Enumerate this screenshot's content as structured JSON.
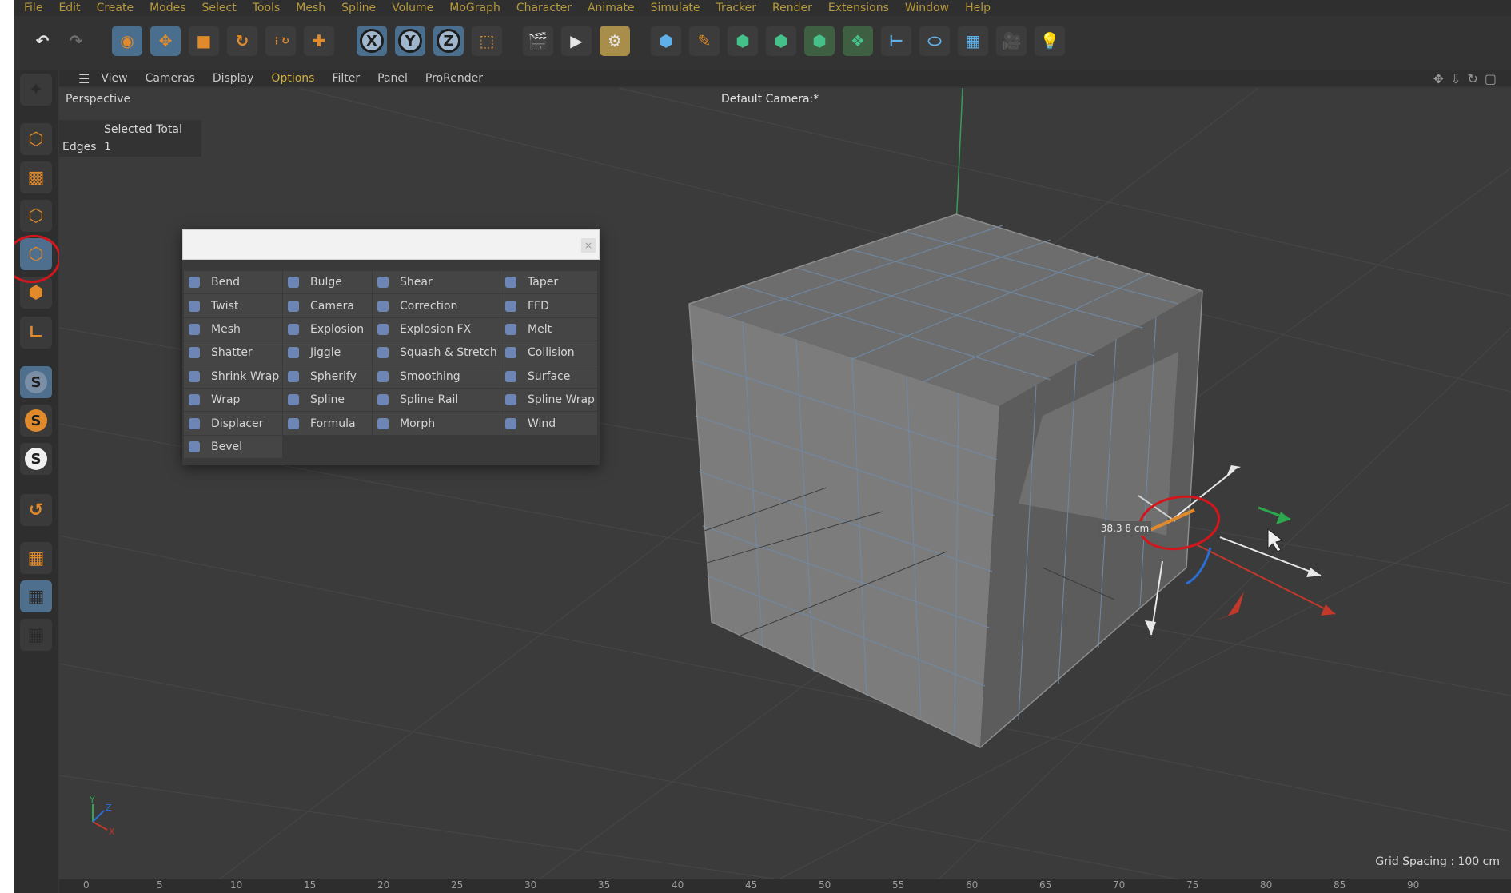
{
  "menubar": {
    "items": [
      "File",
      "Edit",
      "Create",
      "Modes",
      "Select",
      "Tools",
      "Mesh",
      "Spline",
      "Volume",
      "MoGraph",
      "Character",
      "Animate",
      "Simulate",
      "Tracker",
      "Render",
      "Extensions",
      "Window",
      "Help"
    ]
  },
  "toolbar": {
    "undo_icon": "undo-icon",
    "redo_icon": "redo-icon",
    "axis_x": "X",
    "axis_y": "Y",
    "axis_z": "Z"
  },
  "viewport_menu": {
    "items": [
      "View",
      "Cameras",
      "Display",
      "Options",
      "Filter",
      "Panel",
      "ProRender"
    ],
    "highlighted": "Options"
  },
  "viewport": {
    "perspective_label": "Perspective",
    "camera_label": "Default Camera",
    "camera_suffix": ":*",
    "stats_header": "Selected Total",
    "stats_row_label": "Edges",
    "stats_row_value": "1",
    "grid_spacing": "Grid Spacing : 100 cm",
    "measure_label": "38.3 8 cm"
  },
  "deformer_menu": {
    "search_value": "",
    "items": [
      "Bend",
      "Bulge",
      "Shear",
      "Taper",
      "Twist",
      "Camera",
      "Correction",
      "FFD",
      "Mesh",
      "Explosion",
      "Explosion FX",
      "Melt",
      "Shatter",
      "Jiggle",
      "Squash & Stretch",
      "Collision",
      "Shrink Wrap",
      "Spherify",
      "Smoothing",
      "Surface",
      "Wrap",
      "Spline",
      "Spline Rail",
      "Spline Wrap",
      "Displacer",
      "Formula",
      "Morph",
      "Wind",
      "Bevel"
    ]
  },
  "timeline": {
    "ticks": [
      "0",
      "5",
      "10",
      "15",
      "20",
      "25",
      "30",
      "35",
      "40",
      "45",
      "50",
      "55",
      "60",
      "65",
      "70",
      "75",
      "80",
      "85",
      "90"
    ]
  },
  "colors": {
    "menu_text": "#b79a3a",
    "accent_blue": "#4e6f8e",
    "annotation_red": "#d3161c",
    "x_axis": "#c0392b",
    "y_axis": "#2ea84f",
    "z_axis": "#2a6fd6"
  }
}
